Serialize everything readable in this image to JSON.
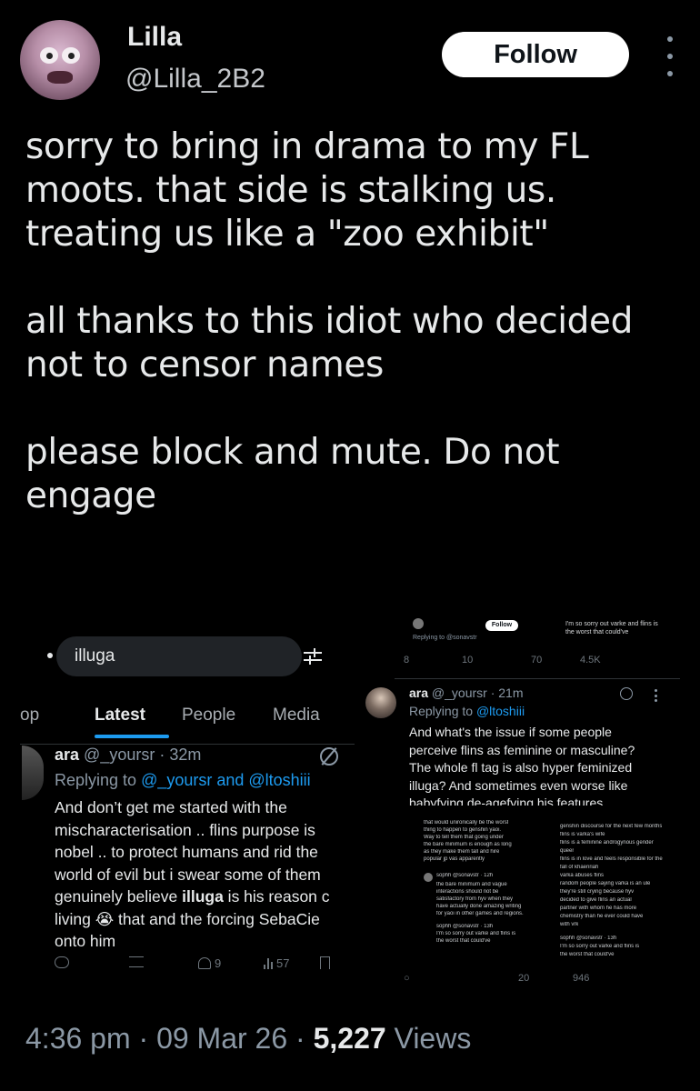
{
  "author": {
    "display_name": "Lilla",
    "handle": "@Lilla_2B2",
    "follow_label": "Follow"
  },
  "tweet": {
    "text": "sorry to bring in drama to my FL\nmoots. that side is stalking us.\ntreating us like a \"zoo exhibit\"\n\nall thanks to this idiot who decided\nnot to censor names\n\nplease block and mute. Do not\nengage",
    "time": "4:36 pm",
    "date": "09 Mar 26",
    "views_count": "5,227",
    "views_label": "Views",
    "separator": "·"
  },
  "left_screenshot": {
    "search_query": "illuga",
    "tabs": [
      {
        "label": "op"
      },
      {
        "label": "Latest"
      },
      {
        "label": "People"
      },
      {
        "label": "Media"
      }
    ],
    "post": {
      "name": "ara",
      "meta": "@_yoursr · 32m",
      "reply_prefix": "Replying to ",
      "reply_mention": "@_yoursr and @ltoshiii",
      "text_before": "And don’t get me started with the\nmischaracterisation .. flins purpose is\nnobel .. to protect humans and rid the\nworld of evil but i swear some of them\ngenuinely believe ",
      "text_bold": "illuga",
      "text_after": " is his reason c\nliving 😭 that and the forcing SebaCie\nonto him",
      "likes": "9",
      "views": "57"
    }
  },
  "right_screenshot": {
    "top_stats": {
      "replies": "8",
      "retweets": "10",
      "likes": "70",
      "views": "4.5K"
    },
    "top_follow_label": "Follow",
    "top_reply_text": "Replying to @sonavstr",
    "top_right_text": "I'm so sorry out varke and flins is\nthe worst that could've",
    "post": {
      "name": "ara",
      "meta": "@_yoursr · 21m",
      "reply_prefix": "Replying to ",
      "reply_mention": "@ltoshiii",
      "text": "And what's the issue if some people\nperceive flins as feminine or masculine?\nThe whole fl tag is also hyper feminized\nilluga? And sometimes even worse like\nbabyfying de-agefying his features"
    },
    "inner_a": {
      "lines": [
        "that would unironically be the worst",
        "thing to happen to genshin yaoi.",
        "Way to tell them that going under",
        "the bare minimum is enough as long",
        "as they make them tall and hire",
        "popular jp vas apparently"
      ],
      "reply_name": "sophh",
      "reply_meta": "@sonavstr · 12h",
      "reply_lines": [
        "the bare minimum and vague",
        "interactions should not be",
        "satisfactory from hyv when they",
        "have actually done amazing writing",
        "for yaoi in other games and regions."
      ],
      "quote_name": "sophh",
      "quote_meta": "@sonavstr · 13h",
      "quote_lines": [
        "I'm so sorry out varke and flins is",
        "the worst that could've"
      ]
    },
    "inner_b": {
      "lines": [
        "genshin discourse for the next few months",
        "flins is varka's wife",
        "flins is a feminine androgynous gender",
        "queer",
        "flins is in love and feels responsible for the",
        "fall of khaenriah",
        "varka abuses flins",
        "random people saying varka is an ule",
        "they're still crying because hyv",
        "decided to give flins an actual",
        "partner with whom he has more",
        "chemistry than he ever could have",
        "with vrk"
      ],
      "quote_name": "sophh",
      "quote_meta": "@sonavstr · 13h",
      "quote_lines": [
        "I'm so sorry out varke and flins is",
        "the worst that could've"
      ]
    },
    "bottom_stats": {
      "likes": "20",
      "views": "946"
    }
  }
}
